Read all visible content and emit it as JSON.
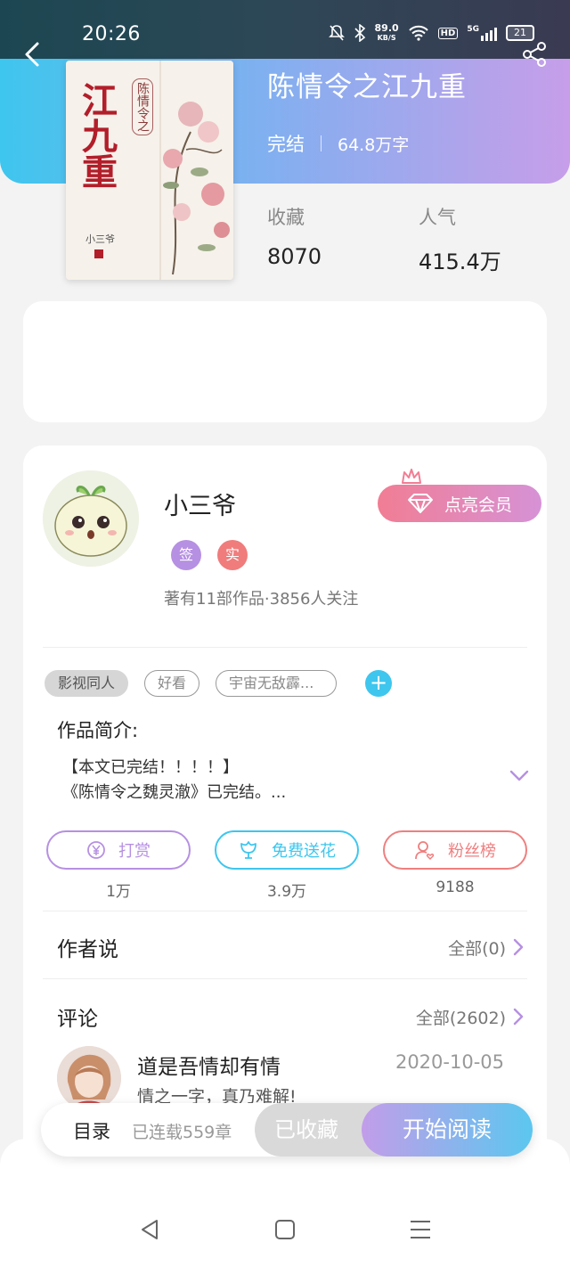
{
  "status_bar": {
    "time": "20:26",
    "net_speed_value": "89.0",
    "net_speed_unit": "KB/S",
    "hd_label": "HD",
    "signal_label": "5G",
    "battery": "21",
    "icons": [
      "mute-bell-icon",
      "bluetooth-icon",
      "wifi-icon",
      "signal-icon",
      "battery-icon"
    ]
  },
  "header": {
    "back_icon": "chevron-left-icon",
    "share_icon": "share-icon"
  },
  "book": {
    "title": "陈情令之江九重",
    "status": "完结",
    "word_count": "64.8万字",
    "cover": {
      "main_title": "江九重",
      "subtitle": "陈情令之",
      "author": "小三爷"
    },
    "stats": [
      {
        "label": "收藏",
        "value": "8070"
      },
      {
        "label": "人气",
        "value": "415.4万"
      }
    ]
  },
  "author": {
    "name": "小三爷",
    "badges": [
      {
        "text": "签",
        "color": "#b690e2"
      },
      {
        "text": "实",
        "color": "#f07c7c"
      }
    ],
    "stats": "著有11部作品·3856人关注",
    "vip_button": "点亮会员"
  },
  "tags": [
    "影视同人",
    "好看",
    "宇宙无敌霹..."
  ],
  "intro": {
    "label": "作品简介:",
    "line1": "【本文已完结！！！！】",
    "line2": "《陈情令之魏灵澈》已完结。..."
  },
  "actions": [
    {
      "label": "打赏",
      "count": "1万",
      "color": "#b690e2",
      "icon": "yen-coin-icon"
    },
    {
      "label": "免费送花",
      "count": "3.9万",
      "color": "#3ec6ee",
      "icon": "flower-icon"
    },
    {
      "label": "粉丝榜",
      "count": "9188",
      "color": "#ef7f7f",
      "icon": "fan-user-icon"
    }
  ],
  "author_says": {
    "title": "作者说",
    "more": "全部(0)"
  },
  "comments": {
    "title": "评论",
    "more": "全部(2602)",
    "first": {
      "user": "道是吾情却有情",
      "date": "2020-10-05",
      "text": "情之一字，真乃难解!"
    }
  },
  "bottom_bar": {
    "toc": "目录",
    "serial": "已连载559章",
    "collected": "已收藏",
    "read": "开始阅读"
  },
  "nav": [
    "back-triangle-icon",
    "home-square-icon",
    "menu-lines-icon"
  ],
  "colors": {
    "accent_blue": "#3ec6ee",
    "accent_purple": "#c79ee9",
    "vip_pink": "#f17d94"
  }
}
